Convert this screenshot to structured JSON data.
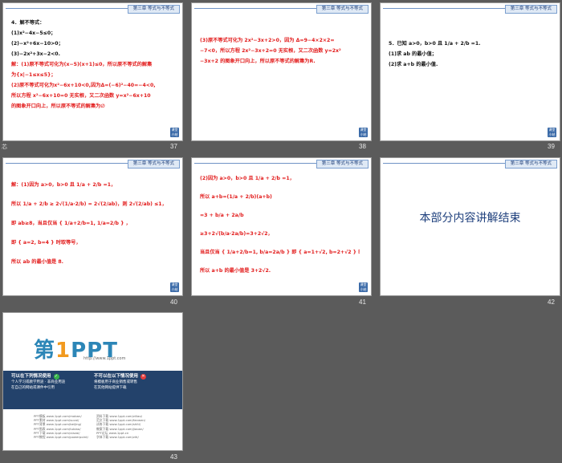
{
  "header_label": "第三章 等式与不等式",
  "nav_label": "课堂小结",
  "side_mark": "芯",
  "slides": [
    {
      "num": "37",
      "lines": [
        {
          "t": "4．解不等式：",
          "c": "blk"
        },
        {
          "t": "(1)x²−4x−5≤0；",
          "c": "blk"
        },
        {
          "t": "(2)−x²+6x−10>0；",
          "c": "blk"
        },
        {
          "t": "(3)−2x²+3x−2<0.",
          "c": "blk"
        },
        {
          "t": "解：(1)原不等式可化为(x−5)(x+1)≤0，所以原不等式的解集",
          "c": "red"
        },
        {
          "t": "为{x|−1≤x≤5}；",
          "c": "red"
        },
        {
          "t": "(2)原不等式可化为x²−6x+10<0,因为Δ=(−6)²−40=−4<0,",
          "c": "red"
        },
        {
          "t": "所以方程 x²−6x+10=0 无实根，又二次函数 y=x²−6x+10",
          "c": "red"
        },
        {
          "t": "的图象开口向上，所以原不等式的解集为∅",
          "c": "red"
        }
      ]
    },
    {
      "num": "38",
      "lines": [
        {
          "t": "(3)原不等式可化为 2x²−3x+2>0，因为 Δ=9−4×2×2=",
          "c": "red"
        },
        {
          "t": "−7<0，所以方程 2x²−3x+2=0 无实根，又二次函数 y=2x²",
          "c": "red"
        },
        {
          "t": "−3x+2 的图象开口向上，所以原不等式的解集为R.",
          "c": "red"
        }
      ]
    },
    {
      "num": "39",
      "lines": [
        {
          "t": "5．已知 a>0，b>0 且 1/a + 2/b =1.",
          "c": "blk"
        },
        {
          "t": "(1)求 ab 的最小值；",
          "c": "blk"
        },
        {
          "t": "(2)求 a+b 的最小值.",
          "c": "blk"
        }
      ]
    },
    {
      "num": "40",
      "lines": [
        {
          "t": "解：(1)因为 a>0，b>0 且 1/a + 2/b =1，",
          "c": "red"
        },
        {
          "t": "所以 1/a + 2/b ≥ 2√(1/a·2/b) = 2√(2/ab)，则 2√(2/ab) ≤1，",
          "c": "red"
        },
        {
          "t": "即 ab≥8，当且仅当 { 1/a+2/b=1, 1/a=2/b } ，",
          "c": "red"
        },
        {
          "t": "即 { a=2, b=4 } 时取等号，",
          "c": "red"
        },
        {
          "t": "所以 ab 的最小值是 8.",
          "c": "red"
        }
      ]
    },
    {
      "num": "41",
      "lines": [
        {
          "t": "(2)因为 a>0，b>0 且 1/a + 2/b =1，",
          "c": "red"
        },
        {
          "t": "所以 a+b=(1/a + 2/b)(a+b)",
          "c": "red"
        },
        {
          "t": "=3 + b/a + 2a/b",
          "c": "red"
        },
        {
          "t": "≥3+2√(b/a·2a/b)=3+2√2，",
          "c": "red"
        },
        {
          "t": "当且仅当 { 1/a+2/b=1, b/a=2a/b } 即 { a=1+√2, b=2+√2 } 时取等号，",
          "c": "red"
        },
        {
          "t": "所以 a+b 的最小值是 3+2√2.",
          "c": "red"
        }
      ]
    },
    {
      "num": "42",
      "title": "本部分内容讲解结束"
    },
    {
      "num": "43",
      "logo_main": "第",
      "logo_one": "1",
      "logo_rest": "PPT",
      "logo_url": "http://www.1ppt.com",
      "can_title": "可以在下列情况使用",
      "cannot_title": "不可以在以下情况使用",
      "can_items": [
        "个人学习或教学用途 · 非商业用途",
        "在自己的网站或课件中引用"
      ],
      "cannot_items": [
        "将模板用于商业销售或转售",
        "在其他网站提供下载"
      ],
      "links_left": [
        "PPT模板 www.1ppt.com/moban/",
        "PPT素材 www.1ppt.com/sucai/",
        "PPT背景 www.1ppt.com/beijing/",
        "PPT图表 www.1ppt.com/tubiao/",
        "PPT下载 www.1ppt.com/xiazai/",
        "PPT教程 www.1ppt.com/powerpoint/"
      ],
      "links_right": [
        "资料下载 www.1ppt.com/ziliao/",
        "范文下载 www.1ppt.com/fanwen/",
        "试卷下载 www.1ppt.com/shiti/",
        "教案下载 www.1ppt.com/jiaoan/",
        "PPT论坛 www.1ppt.cn",
        "字体下载 www.1ppt.com/ziti/"
      ]
    }
  ]
}
